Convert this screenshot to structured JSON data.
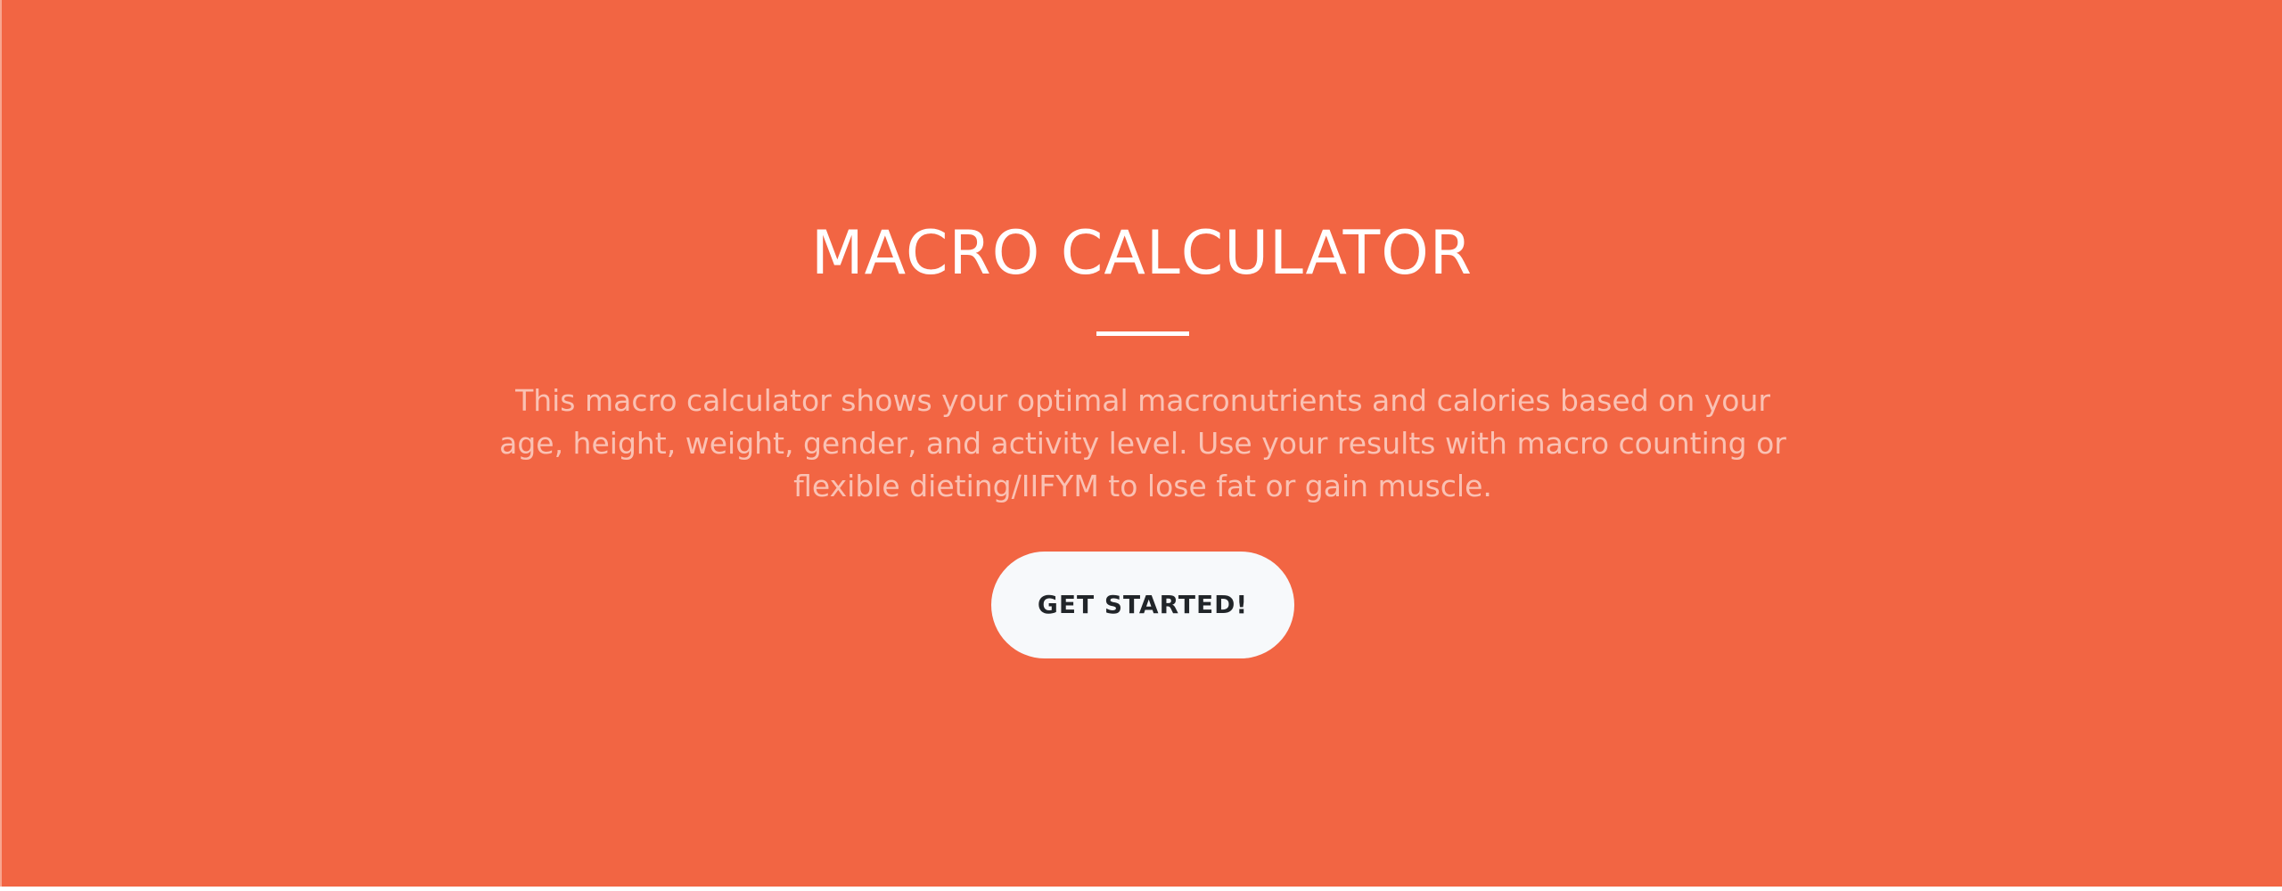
{
  "hero": {
    "title": "MACRO CALCULATOR",
    "description": "This macro calculator shows your optimal macronutrients and calories based on your age, height, weight, gender, and activity level. Use your results with macro counting or flexible dieting/IIFYM to lose fat or gain muscle.",
    "cta_label": "GET STARTED!",
    "background_color": "#f26543",
    "button_color": "#f7f9fb",
    "text_color": "#ffffff"
  }
}
